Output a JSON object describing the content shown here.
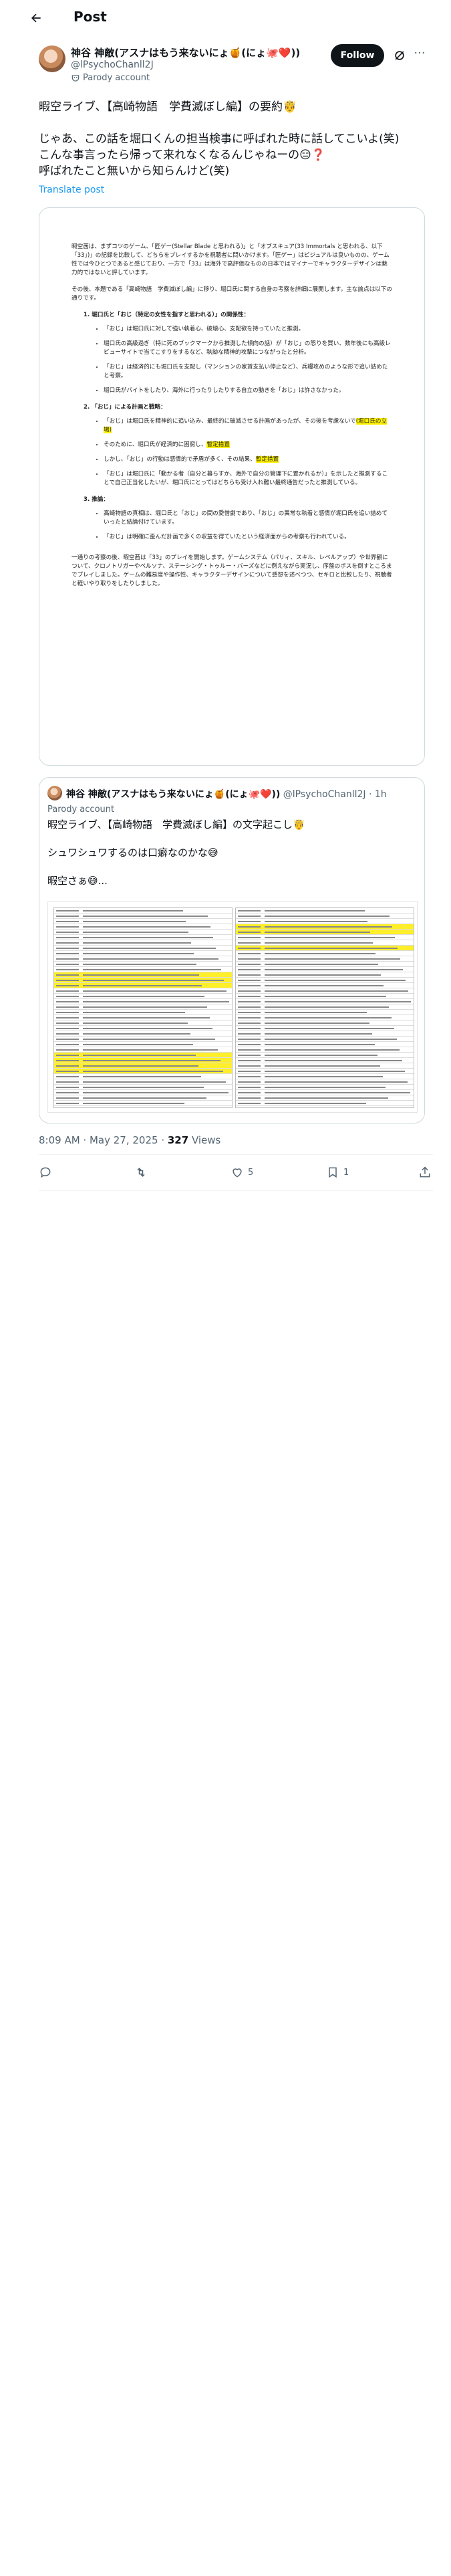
{
  "header": {
    "title": "Post"
  },
  "author": {
    "name": "神谷 神敵(アスナはもう来ないにょ🍯(にょ🐙❤️))",
    "handle": "@lPsychoChanll2J",
    "parody_label": "Parody account",
    "follow_label": "Follow"
  },
  "post": {
    "text": "暇空ライブ、【高崎物語　学費滅ぼし編】の要約🤴\n\nじゃあ、この話を堀口くんの担当検事に呼ばれた時に話してこいよ(笑)\nこんな事言ったら帰って来れなくなるんじゃねーの😑❓\n呼ばれたこと無いから知らんけど(笑)",
    "translate_label": "Translate post"
  },
  "document": {
    "intro": "暇空茜は、まずコツのゲーム、「匠ゲー(Stellar Blade と思われる)」と「オブスキュア(33 Immortals と思われる、以下「33」)」の記録を比較して、どちらをプレイするかを視聴者に問いかけます。「匠ゲー」はビジュアルは良いものの、ゲーム性では今ひとつであると感じており、一方で「33」は海外で高評価なものの日本ではマイナーでキャラクターデザインは魅力的ではないと評しています。",
    "intro2": "その後、本題である「高崎物語　学費滅ぼし編」に移り、堀口氏に関する自身の考察を詳細に展開します。主な論点は以下の通りです。",
    "s1_title": "1.  堀口氏と「おじ（特定の女性を指すと思われる）」の関係性：",
    "s1": [
      "「おじ」は堀口氏に対して強い執着心、破壊心、支配欲を持っていたと推測。",
      "堀口氏の高級過ぎ（特に死のブックマークから推測した傾向の話）が「おじ」の怒りを買い、数年後にも高級レビューサイトで当てこすりをするなど、執拗な精神的攻撃につながったと分析。",
      "「おじ」は経済的にも堀口氏を支配し（マンションの家賃支払い停止など）、兵糧攻めのような形で追い詰めたと考察。",
      "堀口氏がバイトをしたり、海外に行ったりしたりする自立の動きを「おじ」は許さなかった。"
    ],
    "s2_title": "2.  「おじ」による計画と戦略：",
    "s2": [
      "「おじ」は堀口氏を精神的に追い込み、最終的に破滅させる計画があったが、その後を考慮ないで",
      "そのために、堀口氏が経済的に困窮し、",
      "しかし、「おじ」の行動は感情的で矛盾が多く、その結果、",
      "「おじ」は堀口氏に「動かる者（自分と暮らすか、海外で自分の管理下に置かれるか）」を示したと推測することで自己正当化したいが、堀口氏にとってはどちらも受け入れ難い最終通告だったと推測している。"
    ],
    "s2_hl": [
      "(堀口氏の立場)",
      "暫定措置",
      "暫定措置"
    ],
    "s3_title": "3.  推論：",
    "s3": [
      "高崎物語の真相は、堀口氏と「おじ」の間の愛憎劇であり、「おじ」の異常な執着と感情が堀口氏を追い詰めていったと結論付けています。",
      "「おじ」は明確に歪んだ計画で多くの収益を得ていたという経済面からの考察も行われている。"
    ],
    "outro": "一通りの考察の後、暇空茜は「33」のプレイを開始します。ゲームシステム（パリィ、スキル、レベルアップ）や世界観について、クロノトリガーやペルソナ、ステーシング・トゥルー・バーズなどに例えながら実況し、序盤のボスを倒すところまでプレイしました。ゲームの難易度や操作性、キャラクターデザインについて感想を述べつつ、セキロと比較したり、視聴者と軽いやり取りをしたりしました。"
  },
  "quote": {
    "name": "神谷 神敵(アスナはもう来ないにょ🍯(にょ🐙❤️))",
    "handle": "@lPsychoChanll2J",
    "time": "1h",
    "parody_label": "Parody account",
    "text": "暇空ライブ、【高崎物語　学費滅ぼし編】の文字起こし🤴\n\nシュワシュワするのは口癖なのかな😅\n\n暇空さぁ😅..."
  },
  "meta": {
    "time": "8:09 AM · May 27, 2025",
    "separator": " · ",
    "views_count": "327",
    "views_label": " Views"
  },
  "actions": {
    "reply_count": "",
    "repost_count": "",
    "like_count": "5",
    "bookmark_count": "1"
  }
}
